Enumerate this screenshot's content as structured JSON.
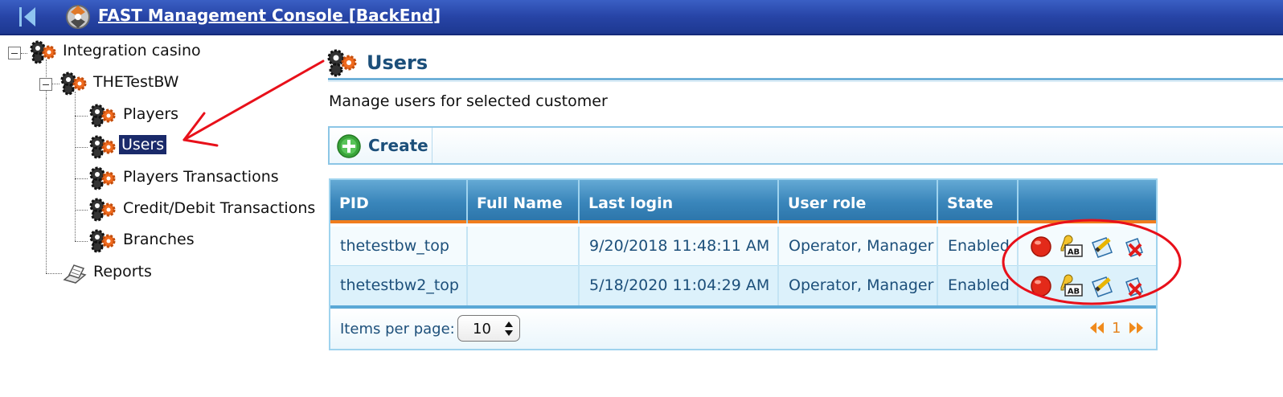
{
  "header": {
    "title": "FAST Management Console [BackEnd]"
  },
  "tree": {
    "root": "Integration casino",
    "customer": "THETestBW",
    "children": [
      "Players",
      "Users",
      "Players Transactions",
      "Credit/Debit Transactions",
      "Branches"
    ],
    "reports": "Reports",
    "selected": "Users"
  },
  "page": {
    "title": "Users",
    "subtitle": "Manage users for selected customer"
  },
  "toolbar": {
    "create_label": "Create"
  },
  "table": {
    "columns": [
      "PID",
      "Full Name",
      "Last login",
      "User role",
      "State"
    ],
    "rows": [
      {
        "pid": "thetestbw_top",
        "full_name": "",
        "last_login": "9/20/2018 11:48:11 AM",
        "role": "Operator, Manager",
        "state": "Enabled"
      },
      {
        "pid": "thetestbw2_top",
        "full_name": "",
        "last_login": "5/18/2020 11:04:29 AM",
        "role": "Operator, Manager",
        "state": "Enabled"
      }
    ],
    "row_actions": [
      "disable-icon",
      "rename-icon",
      "edit-icon",
      "delete-icon"
    ]
  },
  "footer": {
    "items_per_page_label": "Items per page:",
    "items_per_page": "10",
    "current_page": "1"
  },
  "colors": {
    "header": "#2744a6",
    "accent": "#1c4f7a",
    "grid_header": "#3a86bb",
    "orange": "#f07d1e",
    "annotation": "#e8101a"
  }
}
